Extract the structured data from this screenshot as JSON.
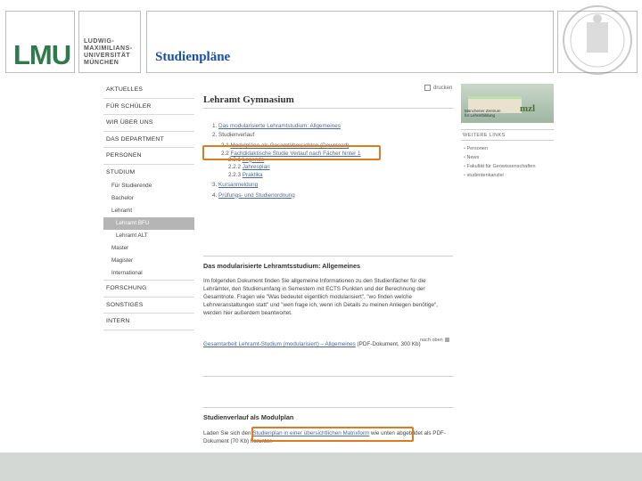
{
  "header": {
    "logo": "LMU",
    "university_lines": [
      "LUDWIG-",
      "MAXIMILIANS-",
      "UNIVERSITÄT",
      "MÜNCHEN"
    ],
    "slide_title": "Studienpläne"
  },
  "nav": {
    "items": [
      {
        "label": "AKTUELLES",
        "type": "top"
      },
      {
        "label": "FÜR SCHÜLER",
        "type": "top"
      },
      {
        "label": "WIR ÜBER UNS",
        "type": "top"
      },
      {
        "label": "DAS DEPARTMENT",
        "type": "top"
      },
      {
        "label": "PERSONEN",
        "type": "top"
      },
      {
        "label": "STUDIUM",
        "type": "top"
      },
      {
        "label": "Für Studierende",
        "type": "sub"
      },
      {
        "label": "Bachelor",
        "type": "sub"
      },
      {
        "label": "Lehramt",
        "type": "sub"
      },
      {
        "label": "Lehramt BFU",
        "type": "sub2",
        "active": true
      },
      {
        "label": "Lehramt ALT",
        "type": "sub2"
      },
      {
        "label": "Master",
        "type": "sub"
      },
      {
        "label": "Magister",
        "type": "sub"
      },
      {
        "label": "International",
        "type": "sub"
      },
      {
        "label": "FORSCHUNG",
        "type": "top"
      },
      {
        "label": "SONSTIGES",
        "type": "top"
      },
      {
        "label": "INTERN",
        "type": "top"
      }
    ]
  },
  "main": {
    "print_label": "drucken",
    "page_title": "Lehramt Gymnasium",
    "toc": [
      {
        "num": "1.",
        "text": "Das modularisierte Lehramtstudium: Allgemeines",
        "link": true,
        "level": 1
      },
      {
        "num": "2.",
        "text": "Studienverlauf",
        "link": false,
        "level": 1
      },
      {
        "num": "2.1",
        "text": "Modulpläne als Gesamtübersichten (Download)",
        "link": true,
        "level": 2
      },
      {
        "num": "2.2",
        "text": "Fachdidaktische Studie Verlauf nach Fächer hinter 1",
        "link": true,
        "level": 2
      },
      {
        "num": "2.2.1",
        "text": "Legende",
        "link": true,
        "level": 3
      },
      {
        "num": "2.2.2",
        "text": "Jahresplan",
        "link": true,
        "level": 3
      },
      {
        "num": "2.2.3",
        "text": "Praktika",
        "link": true,
        "level": 3
      },
      {
        "num": "3.",
        "text": "Kursanmeldung",
        "link": true,
        "level": 1
      },
      {
        "num": "4.",
        "text": "Prüfungs- und Studienordnung",
        "link": true,
        "level": 1
      }
    ],
    "section1": {
      "heading": "Das modularisierte Lehramtsstudium: Allgemeines",
      "body": "Im folgenden Dokument finden Sie allgemeine Informationen zu den Studienfächer für die Lehrämter, den Studienumfang in Semestern mit ECTS Punkten und der Berechnung der Gesamtnote. Fragen wie \"Was bedeutet eigentlich modularisiert\", \"wo finden welche Lehrveranstaltungen statt\" und \"wen frage ich, wenn ich Details zu meinen Anliegen benötige\", werden hier außerdem beantwortet.",
      "doc_link": "Gesamtarbeit Lehramt-Studium (modularisiert) – Allgemeines",
      "doc_suffix": "(PDF-Dokument, 300 Kb)",
      "top_link": "nach oben"
    },
    "section2": {
      "heading": "Studienverlauf als Modulplan",
      "body_start": "Laden Sie sich den ",
      "body_link": "Studienplan in einer übersichtlichen Matrixform",
      "body_end": " wie unten abgebildet als PDF-Dokument (70 Kb) herunter."
    }
  },
  "sidebar": {
    "image_caption": [
      "Münchener Zentrum",
      "für Lehrerbildung"
    ],
    "image_logo": "mzl",
    "links_heading": "WEITERE LINKS",
    "links": [
      "Personen",
      "News",
      "Fakultät für Geowissenschaften",
      "studentenkanzlei"
    ]
  }
}
